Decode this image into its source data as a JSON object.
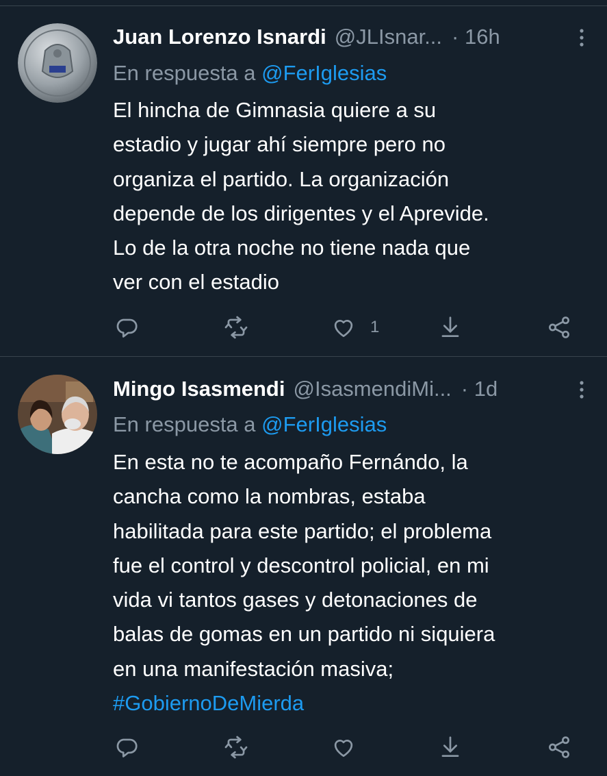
{
  "tweets": [
    {
      "author_name": "Juan Lorenzo Isnardi",
      "handle": "@JLIsnar...",
      "time": "· 16h",
      "reply_prefix": "En respuesta a",
      "reply_mention": "@FerIglesias",
      "body_lines": [
        "El hincha de Gimnasia quiere a su",
        "estadio y jugar ahí siempre pero no",
        "organiza el partido.  La organización",
        "depende de los dirigentes y el Aprevide.",
        "Lo de la otra noche no tiene nada que",
        "ver con el estadio"
      ],
      "hashtag": "",
      "actions": {
        "reply_icon": "reply-icon",
        "retweet_icon": "retweet-icon",
        "like_icon": "like-icon",
        "like_count": "1",
        "download_icon": "download-icon",
        "share_icon": "share-icon"
      }
    },
    {
      "author_name": "Mingo Isasmendi",
      "handle": "@IsasmendiMi...",
      "time": "· 1d",
      "reply_prefix": "En respuesta a",
      "reply_mention": "@FerIglesias",
      "body_lines": [
        "En esta no te acompaño Fernándo, la",
        "cancha como la nombras, estaba",
        "habilitada para este partido; el problema",
        "fue el control y descontrol policial, en mi",
        "vida vi tantos gases y detonaciones de",
        "balas de gomas en un partido ni siquiera",
        "en una manifestación masiva;"
      ],
      "hashtag": "#GobiernoDeMierda",
      "actions": {
        "reply_icon": "reply-icon",
        "retweet_icon": "retweet-icon",
        "like_icon": "like-icon",
        "like_count": "",
        "download_icon": "download-icon",
        "share_icon": "share-icon"
      }
    }
  ],
  "colors": {
    "background": "#15202b",
    "text_primary": "#ffffff",
    "text_secondary": "#8b98a5",
    "accent": "#1d9bf0",
    "divider": "#38444d"
  }
}
